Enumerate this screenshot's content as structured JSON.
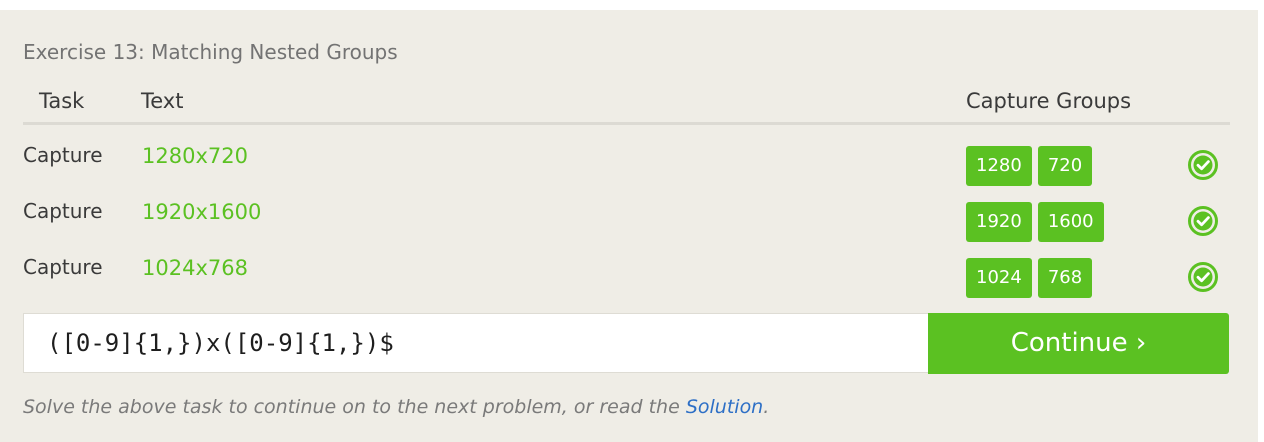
{
  "exercise": {
    "title": "Exercise 13: Matching Nested Groups"
  },
  "table": {
    "headers": {
      "task": "Task",
      "text": "Text",
      "capture_groups": "Capture Groups"
    },
    "rows": [
      {
        "task": "Capture",
        "text": "1280x720",
        "groups": [
          "1280",
          "720"
        ],
        "status": "check-circle-icon"
      },
      {
        "task": "Capture",
        "text": "1920x1600",
        "groups": [
          "1920",
          "1600"
        ],
        "status": "check-circle-icon"
      },
      {
        "task": "Capture",
        "text": "1024x768",
        "groups": [
          "1024",
          "768"
        ],
        "status": "check-circle-icon"
      }
    ]
  },
  "input": {
    "value": "([0-9]{1,})x([0-9]{1,})$"
  },
  "continue_button": {
    "label": "Continue ›"
  },
  "footer": {
    "text_before": "Solve the above task to continue on to the next problem, or read the ",
    "link": "Solution",
    "text_after": "."
  },
  "colors": {
    "accent_green": "#5bc122",
    "panel_background": "#efede6",
    "link_blue": "#2d6fc6"
  }
}
